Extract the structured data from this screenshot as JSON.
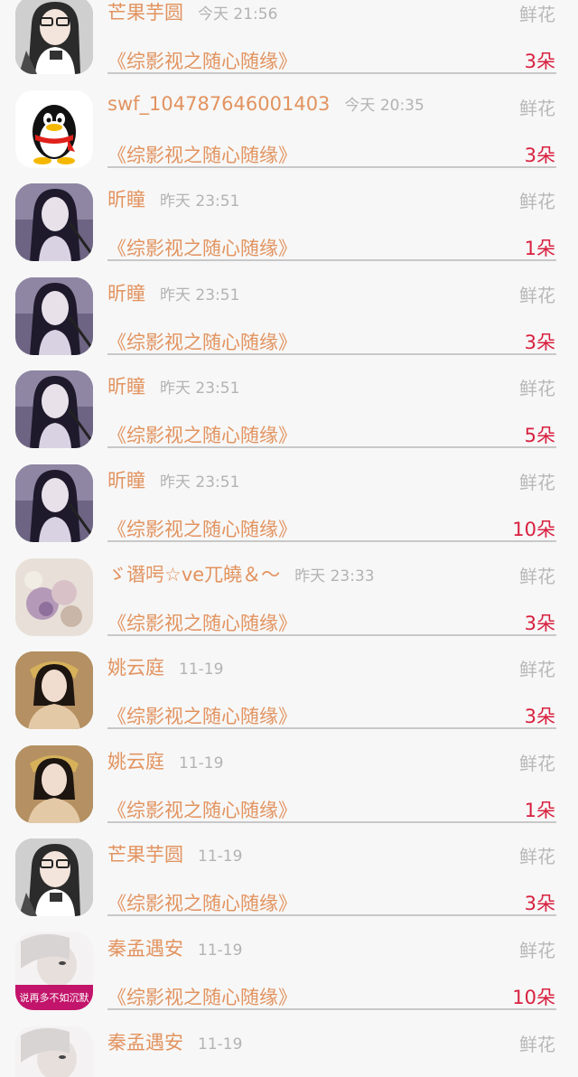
{
  "gift_records": [
    {
      "name": "芒果芋圆",
      "time": "今天 21:56",
      "gift_type": "鲜花",
      "book": "《综影视之随心随缘》",
      "count": "3朵",
      "avatar": "anime-girl-white"
    },
    {
      "name": "swf_104787646001403",
      "time": "今天 20:35",
      "gift_type": "鲜花",
      "book": "《综影视之随心随缘》",
      "count": "3朵",
      "avatar": "qq-penguin"
    },
    {
      "name": "昕瞳",
      "time": "昨天 23:51",
      "gift_type": "鲜花",
      "book": "《综影视之随心随缘》",
      "count": "1朵",
      "avatar": "anime-girl-purple"
    },
    {
      "name": "昕瞳",
      "time": "昨天 23:51",
      "gift_type": "鲜花",
      "book": "《综影视之随心随缘》",
      "count": "3朵",
      "avatar": "anime-girl-purple"
    },
    {
      "name": "昕瞳",
      "time": "昨天 23:51",
      "gift_type": "鲜花",
      "book": "《综影视之随心随缘》",
      "count": "5朵",
      "avatar": "anime-girl-purple"
    },
    {
      "name": "昕瞳",
      "time": "昨天 23:51",
      "gift_type": "鲜花",
      "book": "《综影视之随心随缘》",
      "count": "10朵",
      "avatar": "anime-girl-purple"
    },
    {
      "name": "ゞ谮呺☆ve兀皢＆～",
      "time": "昨天 23:33",
      "gift_type": "鲜花",
      "book": "《综影视之随心随缘》",
      "count": "3朵",
      "avatar": "flower-photo"
    },
    {
      "name": "姚云庭",
      "time": "11-19",
      "gift_type": "鲜花",
      "book": "《综影视之随心随缘》",
      "count": "3朵",
      "avatar": "costume-woman"
    },
    {
      "name": "姚云庭",
      "time": "11-19",
      "gift_type": "鲜花",
      "book": "《综影视之随心随缘》",
      "count": "1朵",
      "avatar": "costume-woman"
    },
    {
      "name": "芒果芋圆",
      "time": "11-19",
      "gift_type": "鲜花",
      "book": "《综影视之随心随缘》",
      "count": "3朵",
      "avatar": "anime-girl-white"
    },
    {
      "name": "秦孟遇安",
      "time": "11-19",
      "gift_type": "鲜花",
      "book": "《综影视之随心随缘》",
      "count": "10朵",
      "avatar": "photo-caption",
      "avatar_caption": "说再多不如沉默"
    },
    {
      "name": "秦孟遇安",
      "time": "11-19",
      "gift_type": "鲜花",
      "book": "",
      "count": "",
      "avatar": "photo-caption"
    }
  ],
  "colors": {
    "name": "#e2935f",
    "time": "#b3b3b3",
    "gift_type": "#b8b8b8",
    "count": "#d8203f",
    "divider": "#c8c8c8",
    "background": "#f7f7f7"
  }
}
